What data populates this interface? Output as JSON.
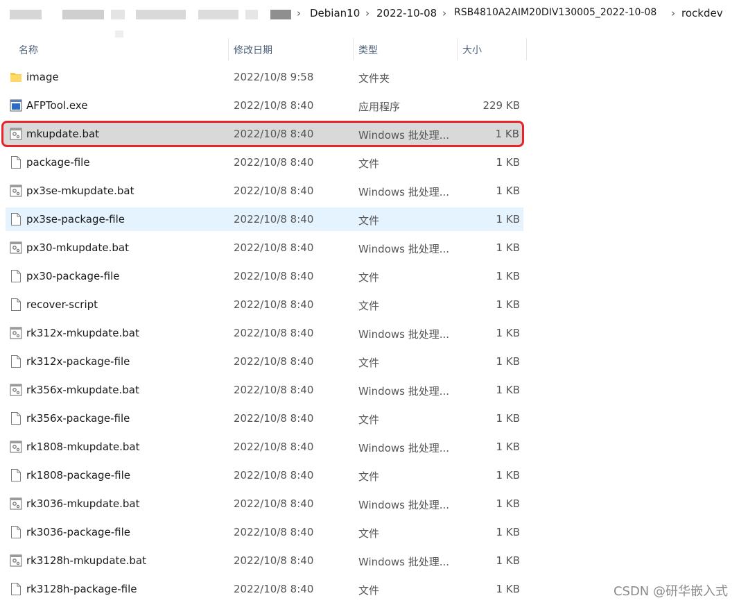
{
  "breadcrumb": {
    "items": [
      "Debian10",
      "2022-10-08",
      "RSB4810A2AIM20DIV130005_2022-10-08",
      "rockdev"
    ],
    "separator": "›"
  },
  "columns": {
    "name": "名称",
    "date": "修改日期",
    "type": "类型",
    "size": "大小"
  },
  "files": [
    {
      "name": "image",
      "date": "2022/10/8 9:58",
      "type": "文件夹",
      "size": "",
      "icon": "folder-icon",
      "state": ""
    },
    {
      "name": "AFPTool.exe",
      "date": "2022/10/8 8:40",
      "type": "应用程序",
      "size": "229 KB",
      "icon": "exe-icon",
      "state": ""
    },
    {
      "name": "mkupdate.bat",
      "date": "2022/10/8 8:40",
      "type": "Windows 批处理...",
      "size": "1 KB",
      "icon": "batch-file-icon",
      "state": "selected"
    },
    {
      "name": "package-file",
      "date": "2022/10/8 8:40",
      "type": "文件",
      "size": "1 KB",
      "icon": "file-icon",
      "state": ""
    },
    {
      "name": "px3se-mkupdate.bat",
      "date": "2022/10/8 8:40",
      "type": "Windows 批处理...",
      "size": "1 KB",
      "icon": "batch-file-icon",
      "state": ""
    },
    {
      "name": "px3se-package-file",
      "date": "2022/10/8 8:40",
      "type": "文件",
      "size": "1 KB",
      "icon": "file-icon",
      "state": "hover"
    },
    {
      "name": "px30-mkupdate.bat",
      "date": "2022/10/8 8:40",
      "type": "Windows 批处理...",
      "size": "1 KB",
      "icon": "batch-file-icon",
      "state": ""
    },
    {
      "name": "px30-package-file",
      "date": "2022/10/8 8:40",
      "type": "文件",
      "size": "1 KB",
      "icon": "file-icon",
      "state": ""
    },
    {
      "name": "recover-script",
      "date": "2022/10/8 8:40",
      "type": "文件",
      "size": "1 KB",
      "icon": "file-icon",
      "state": ""
    },
    {
      "name": "rk312x-mkupdate.bat",
      "date": "2022/10/8 8:40",
      "type": "Windows 批处理...",
      "size": "1 KB",
      "icon": "batch-file-icon",
      "state": ""
    },
    {
      "name": "rk312x-package-file",
      "date": "2022/10/8 8:40",
      "type": "文件",
      "size": "1 KB",
      "icon": "file-icon",
      "state": ""
    },
    {
      "name": "rk356x-mkupdate.bat",
      "date": "2022/10/8 8:40",
      "type": "Windows 批处理...",
      "size": "1 KB",
      "icon": "batch-file-icon",
      "state": ""
    },
    {
      "name": "rk356x-package-file",
      "date": "2022/10/8 8:40",
      "type": "文件",
      "size": "1 KB",
      "icon": "file-icon",
      "state": ""
    },
    {
      "name": "rk1808-mkupdate.bat",
      "date": "2022/10/8 8:40",
      "type": "Windows 批处理...",
      "size": "1 KB",
      "icon": "batch-file-icon",
      "state": ""
    },
    {
      "name": "rk1808-package-file",
      "date": "2022/10/8 8:40",
      "type": "文件",
      "size": "1 KB",
      "icon": "file-icon",
      "state": ""
    },
    {
      "name": "rk3036-mkupdate.bat",
      "date": "2022/10/8 8:40",
      "type": "Windows 批处理...",
      "size": "1 KB",
      "icon": "batch-file-icon",
      "state": ""
    },
    {
      "name": "rk3036-package-file",
      "date": "2022/10/8 8:40",
      "type": "文件",
      "size": "1 KB",
      "icon": "file-icon",
      "state": ""
    },
    {
      "name": "rk3128h-mkupdate.bat",
      "date": "2022/10/8 8:40",
      "type": "Windows 批处理...",
      "size": "1 KB",
      "icon": "batch-file-icon",
      "state": ""
    },
    {
      "name": "rk3128h-package-file",
      "date": "2022/10/8 8:40",
      "type": "文件",
      "size": "1 KB",
      "icon": "file-icon",
      "state": ""
    }
  ],
  "annotation_color": "#e8232a",
  "selected_row_color": "#d9d9d9",
  "hover_row_color": "#e5f3ff",
  "watermark": "CSDN @研华嵌入式"
}
